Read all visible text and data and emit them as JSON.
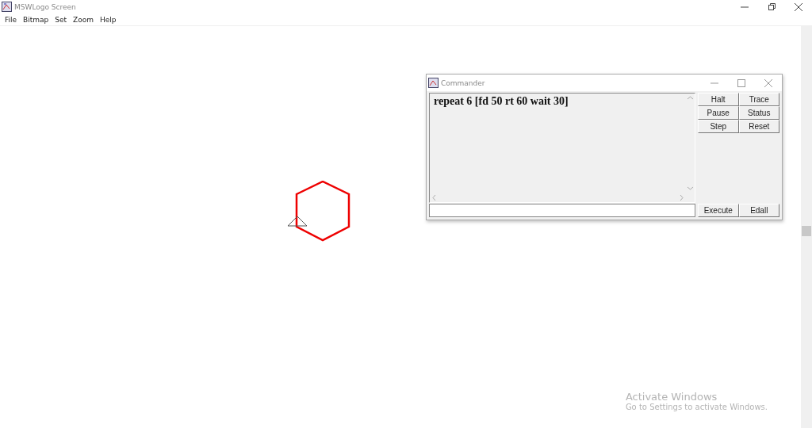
{
  "window": {
    "title": "MSWLogo Screen"
  },
  "menu": [
    "File",
    "Bitmap",
    "Set",
    "Zoom",
    "Help"
  ],
  "commander": {
    "title": "Commander",
    "history": [
      "repeat 6 [fd 50 rt 60 wait 30]"
    ],
    "buttons": [
      "Halt",
      "Trace",
      "Pause",
      "Status",
      "Step",
      "Reset"
    ],
    "bottom_buttons": [
      "Execute",
      "Edall"
    ]
  },
  "activation_notice": {
    "title": "Activate Windows",
    "text": "Go to Settings to activate Windows."
  }
}
